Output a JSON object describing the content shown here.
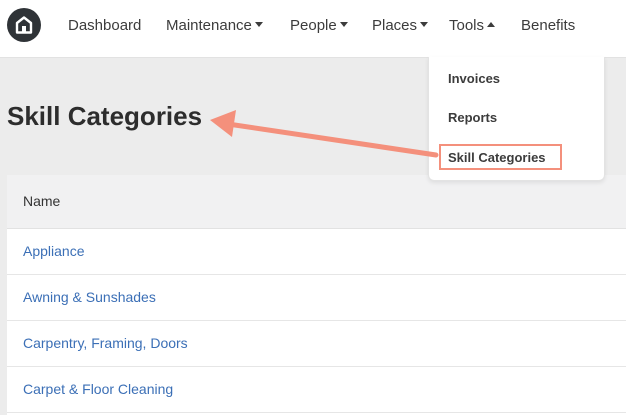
{
  "colors": {
    "link": "#3b6fb6",
    "annotation": "#f4907c",
    "logo_bg": "#2f3337"
  },
  "logo": {
    "icon": "home-icon"
  },
  "nav": {
    "dashboard": "Dashboard",
    "maintenance": "Maintenance",
    "people": "People",
    "places": "Places",
    "tools": "Tools",
    "benefits": "Benefits"
  },
  "tools_menu": {
    "items": [
      "Invoices",
      "Reports",
      "Skill Categories"
    ],
    "highlighted": "Skill Categories"
  },
  "page": {
    "title": "Skill Categories"
  },
  "table": {
    "column_header": "Name",
    "rows": [
      "Appliance",
      "Awning & Sunshades",
      "Carpentry, Framing, Doors",
      "Carpet & Floor Cleaning"
    ]
  }
}
